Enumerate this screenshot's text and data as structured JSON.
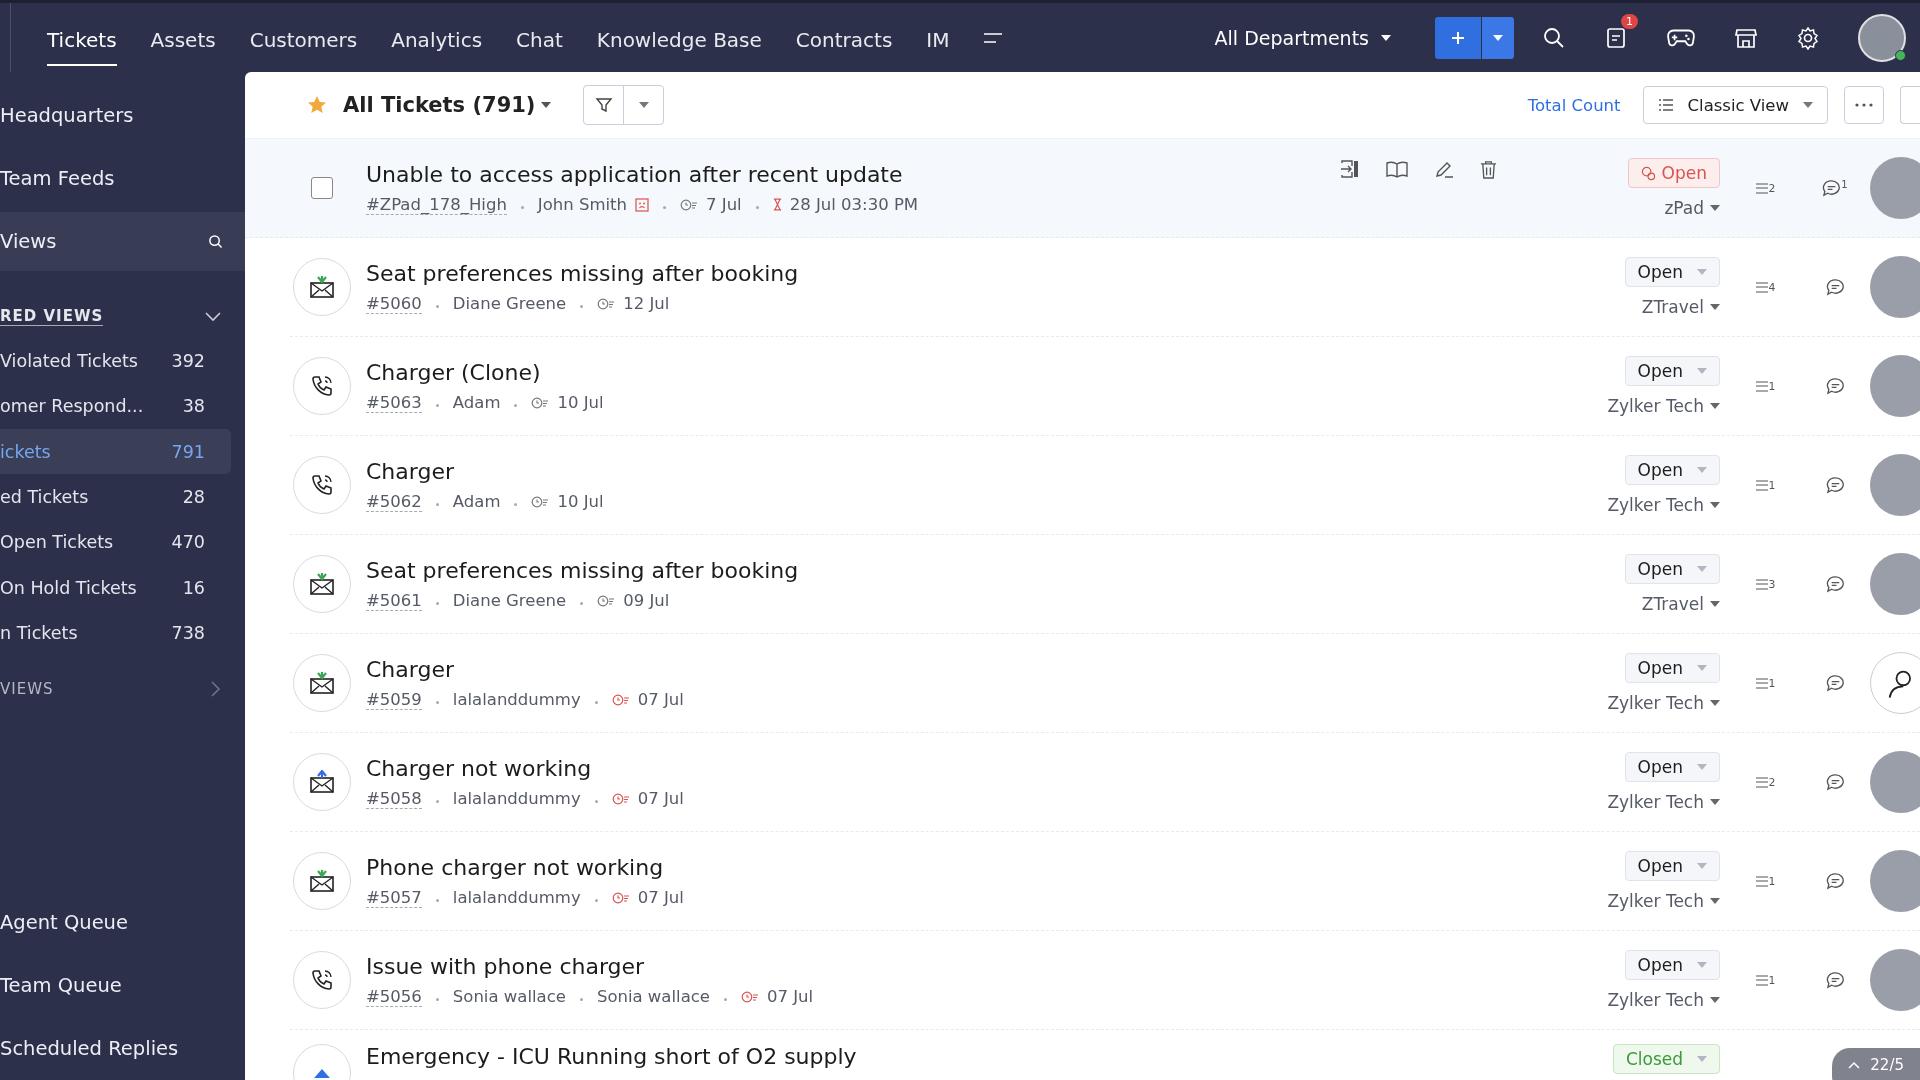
{
  "topnav": {
    "tabs": [
      {
        "label": "Tickets",
        "selected": true
      },
      {
        "label": "Assets",
        "selected": false
      },
      {
        "label": "Customers",
        "selected": false
      },
      {
        "label": "Analytics",
        "selected": false
      },
      {
        "label": "Chat",
        "selected": false
      },
      {
        "label": "Knowledge Base",
        "selected": false
      },
      {
        "label": "Contracts",
        "selected": false
      },
      {
        "label": "IM",
        "selected": false
      }
    ],
    "department": "All Departments",
    "notification_badge": "1"
  },
  "sidebar": {
    "top_items": [
      {
        "label": "Headquarters"
      },
      {
        "label": "Team Feeds"
      }
    ],
    "views_search": "Views",
    "starred_heading": "RED VIEWS",
    "views": [
      {
        "label": "Violated Tickets",
        "count": "392",
        "selected": false
      },
      {
        "label": "omer Respond...",
        "count": "38",
        "selected": false
      },
      {
        "label": "ickets",
        "count": "791",
        "selected": true
      },
      {
        "label": "ed Tickets",
        "count": "28",
        "selected": false
      },
      {
        "label": "Open Tickets",
        "count": "470",
        "selected": false
      },
      {
        "label": "On Hold Tickets",
        "count": "16",
        "selected": false
      },
      {
        "label": "n Tickets",
        "count": "738",
        "selected": false
      }
    ],
    "other_heading": "VIEWS",
    "bottom_items": [
      {
        "label": "Agent Queue"
      },
      {
        "label": "Team Queue"
      },
      {
        "label": "Scheduled Replies"
      }
    ]
  },
  "header": {
    "title": "All Tickets (791)",
    "total_count": "Total Count",
    "view": "Classic View"
  },
  "tickets": [
    {
      "hovered": true,
      "subject": "Unable to access application after recent update",
      "id": "#ZPad_178_High",
      "contacts": [
        "John Smith"
      ],
      "unhappy": true,
      "due": "7 Jul",
      "overdue": false,
      "sla": "28 Jul 03:30 PM",
      "status": {
        "label": "Open",
        "kind": "overdue"
      },
      "account": "zPad",
      "threads": "2",
      "comments": "1",
      "assignee": {
        "kind": "photo"
      }
    },
    {
      "hovered": false,
      "channel": {
        "kind": "mail-in"
      },
      "subject": "Seat preferences missing after booking",
      "id": "#5060",
      "contacts": [
        "Diane Greene"
      ],
      "unhappy": false,
      "due": "12 Jul",
      "overdue": false,
      "status": {
        "label": "Open",
        "kind": "open"
      },
      "account": "ZTravel",
      "threads": "4",
      "assignee": {
        "kind": "photo"
      }
    },
    {
      "hovered": false,
      "channel": {
        "kind": "phone"
      },
      "subject": "Charger (Clone)",
      "id": "#5063",
      "contacts": [
        "Adam"
      ],
      "unhappy": false,
      "due": "10 Jul",
      "overdue": false,
      "status": {
        "label": "Open",
        "kind": "open"
      },
      "account": "Zylker Tech",
      "threads": "1",
      "assignee": {
        "kind": "photo"
      }
    },
    {
      "hovered": false,
      "channel": {
        "kind": "phone"
      },
      "subject": "Charger",
      "id": "#5062",
      "contacts": [
        "Adam"
      ],
      "unhappy": false,
      "due": "10 Jul",
      "overdue": false,
      "status": {
        "label": "Open",
        "kind": "open"
      },
      "account": "Zylker Tech",
      "threads": "1",
      "assignee": {
        "kind": "photo"
      }
    },
    {
      "hovered": false,
      "channel": {
        "kind": "mail-in"
      },
      "subject": "Seat preferences missing after booking",
      "id": "#5061",
      "contacts": [
        "Diane Greene"
      ],
      "unhappy": false,
      "due": "09 Jul",
      "overdue": false,
      "status": {
        "label": "Open",
        "kind": "open"
      },
      "account": "ZTravel",
      "threads": "3",
      "assignee": {
        "kind": "photo"
      }
    },
    {
      "hovered": false,
      "channel": {
        "kind": "mail-in"
      },
      "subject": "Charger",
      "id": "#5059",
      "contacts": [
        "lalalanddummy"
      ],
      "unhappy": false,
      "due": "07 Jul",
      "overdue": true,
      "status": {
        "label": "Open",
        "kind": "open"
      },
      "account": "Zylker Tech",
      "threads": "1",
      "assignee": {
        "kind": "unassigned"
      }
    },
    {
      "hovered": false,
      "channel": {
        "kind": "mail-out"
      },
      "subject": "Charger not working",
      "id": "#5058",
      "contacts": [
        "lalalanddummy"
      ],
      "unhappy": false,
      "due": "07 Jul",
      "overdue": true,
      "status": {
        "label": "Open",
        "kind": "open"
      },
      "account": "Zylker Tech",
      "threads": "2",
      "assignee": {
        "kind": "photo"
      }
    },
    {
      "hovered": false,
      "channel": {
        "kind": "mail-in"
      },
      "subject": "Phone charger not working",
      "id": "#5057",
      "contacts": [
        "lalalanddummy"
      ],
      "unhappy": false,
      "due": "07 Jul",
      "overdue": true,
      "status": {
        "label": "Open",
        "kind": "open"
      },
      "account": "Zylker Tech",
      "threads": "1",
      "assignee": {
        "kind": "photo"
      }
    },
    {
      "hovered": false,
      "channel": {
        "kind": "phone"
      },
      "subject": "Issue with phone charger",
      "id": "#5056",
      "contacts": [
        "Sonia wallace",
        "Sonia wallace"
      ],
      "unhappy": false,
      "due": "07 Jul",
      "overdue": true,
      "status": {
        "label": "Open",
        "kind": "open"
      },
      "account": "Zylker Tech",
      "threads": "1",
      "assignee": {
        "kind": "photo"
      }
    },
    {
      "hovered": false,
      "channel": {
        "kind": "web"
      },
      "subject": "Emergency - ICU Running short of O2 supply",
      "status": {
        "label": "Closed",
        "kind": "closed"
      }
    }
  ],
  "pager": "22/5"
}
